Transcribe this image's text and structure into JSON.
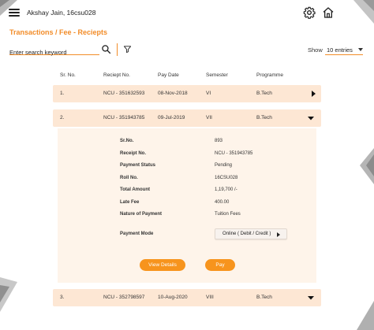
{
  "header": {
    "username": "Akshay Jain, 16csu028"
  },
  "breadcrumb": "Transactions / Fee - Reciepts",
  "search": {
    "placeholder": "Enter search keyword",
    "value": ""
  },
  "entries": {
    "show_label": "Show",
    "selected": "10 entries"
  },
  "table": {
    "columns": [
      "Sr. No.",
      "Reciept No.",
      "Pay Date",
      "Semester",
      "Programme"
    ],
    "rows": [
      {
        "sr": "1.",
        "receipt": "NCU - 351632593",
        "date": "08-Nov-2018",
        "semester": "VI",
        "programme": "B.Tech",
        "expanded": false
      },
      {
        "sr": "2.",
        "receipt": "NCU - 351943785",
        "date": "09-Jul-2019",
        "semester": "VII",
        "programme": "B.Tech",
        "expanded": true
      },
      {
        "sr": "3.",
        "receipt": "NCU - 352798597",
        "date": "10-Aug-2020",
        "semester": "VIII",
        "programme": "B.Tech",
        "expanded": true
      }
    ]
  },
  "details": {
    "fields": [
      {
        "label": "Sr.No.",
        "value": "893"
      },
      {
        "label": "Receipt No.",
        "value": "NCU - 351943785"
      },
      {
        "label": "Payment Status",
        "value": "Pending"
      },
      {
        "label": "Roll No.",
        "value": "16CSU028"
      },
      {
        "label": "Total Amount",
        "value": "1,19,700 /-"
      },
      {
        "label": "Late Fee",
        "value": "400.00"
      },
      {
        "label": "Nature of Payment",
        "value": "Tuition Fees"
      }
    ],
    "payment_mode_label": "Payment Mode",
    "payment_mode_value": "Online ( Debit / Credit )",
    "view_details_label": "View Details",
    "pay_label": "Pay"
  },
  "colors": {
    "accent": "#f28c28",
    "button": "#f7941d",
    "row_bg": "#fde7d4",
    "panel_bg": "#fef4ea"
  }
}
